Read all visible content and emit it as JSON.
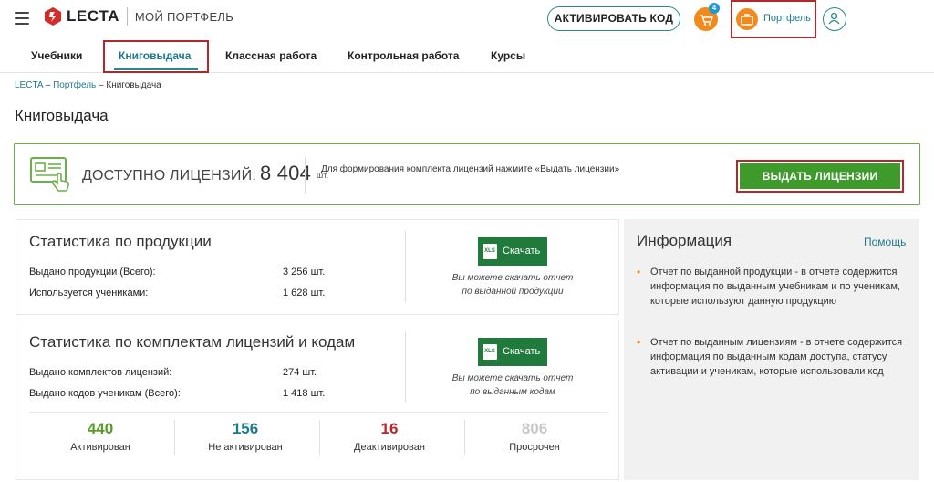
{
  "header": {
    "logo_text": "LECTA",
    "logo_sub": "МОЙ ПОРТФЕЛЬ",
    "activate_label": "АКТИВИРОВАТЬ КОД",
    "cart_count": "4",
    "portfolio_label": "Портфель"
  },
  "tabs": [
    {
      "label": "Учебники"
    },
    {
      "label": "Книговыдача"
    },
    {
      "label": "Классная работа"
    },
    {
      "label": "Контрольная работа"
    },
    {
      "label": "Курсы"
    }
  ],
  "breadcrumb": {
    "root": "LECTA",
    "sep": " – ",
    "portfolio": "Портфель",
    "current": "Книговыдача"
  },
  "page_title": "Книговыдача",
  "licenses": {
    "label": "ДОСТУПНО ЛИЦЕНЗИЙ:",
    "count": "8 404",
    "unit": "шт.",
    "note": "Для формирования комплекта лицензий нажмите «Выдать лицензии»",
    "issue_label": "ВЫДАТЬ ЛИЦЕНЗИИ"
  },
  "product_stats": {
    "title": "Статистика по продукции",
    "rows": [
      {
        "label": "Выдано продукции (Всего):",
        "value": "3 256 шт."
      },
      {
        "label": "Используется учениками:",
        "value": "1 628 шт."
      }
    ],
    "download_label": "Скачать",
    "xls": "XLS",
    "note_line1": "Вы можете скачать отчет",
    "note_line2": "по выданной продукции"
  },
  "kit_stats": {
    "title": "Статистика по комплектам лицензий и кодам",
    "rows": [
      {
        "label": "Выдано комплектов лицензий:",
        "value": "274 шт."
      },
      {
        "label": "Выдано кодов ученикам (Всего):",
        "value": "1 418 шт."
      }
    ],
    "download_label": "Скачать",
    "xls": "XLS",
    "note_line1": "Вы можете скачать отчет",
    "note_line2": "по выданным кодам",
    "counts": [
      {
        "num": "440",
        "label": "Активирован",
        "color": "#5a9a2a"
      },
      {
        "num": "156",
        "label": "Не активирован",
        "color": "#1e7a90"
      },
      {
        "num": "16",
        "label": "Деактивирован",
        "color": "#b3282d"
      },
      {
        "num": "806",
        "label": "Просрочен",
        "color": "#c8c8c8"
      }
    ]
  },
  "info": {
    "title": "Информация",
    "help": "Помощь",
    "items": [
      "Отчет по выданной продукции - в отчете содержится информация по выданным учебникам и по ученикам, которые используют данную продукцию",
      "Отчет по выданным лицензиям - в отчете содержится информация по выданным кодам доступа, статусу активации и ученикам, которые использовали код"
    ]
  },
  "colors": {
    "accent_teal": "#2a8a8a",
    "accent_orange": "#f08a1c",
    "primary_green": "#3f9a2c",
    "excel_green": "#1f7a3c",
    "highlight_red": "#b3282d"
  }
}
